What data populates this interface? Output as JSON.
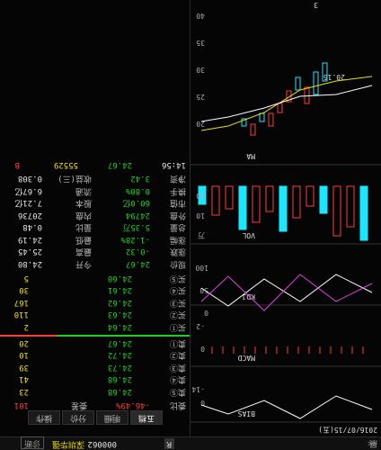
{
  "toolbar": {
    "back": "<<",
    "back_label": "展开",
    "flag": "R",
    "code": "000062",
    "name": "深圳华强",
    "news_btn": "诊断"
  },
  "tabs": [
    "五档",
    "明细",
    "分价",
    "操作"
  ],
  "webi": {
    "label": "委比",
    "value": "-46.49%",
    "diff_label": "委差",
    "diff": "101"
  },
  "sell": [
    {
      "label": "卖⑤",
      "price": "24.68",
      "vol": "23"
    },
    {
      "label": "卖④",
      "price": "24.68",
      "vol": "41"
    },
    {
      "label": "卖③",
      "price": "24.73",
      "vol": "39"
    },
    {
      "label": "卖②",
      "price": "24.72",
      "vol": "10"
    },
    {
      "label": "卖①",
      "price": "24.67",
      "vol": "20"
    }
  ],
  "buy": [
    {
      "label": "买①",
      "price": "24.64",
      "vol": "2"
    },
    {
      "label": "买②",
      "price": "24.63",
      "vol": "110"
    },
    {
      "label": "买③",
      "price": "24.62",
      "vol": "167"
    },
    {
      "label": "买④",
      "price": "24.61",
      "vol": "30"
    },
    {
      "label": "买⑤",
      "price": "24.60",
      "vol": "5"
    }
  ],
  "stats": [
    [
      "现价",
      "24.67",
      "今开",
      "24.80"
    ],
    [
      "涨跌",
      "-0.32",
      "最高",
      "25.45"
    ],
    [
      "涨幅",
      "-1.28%",
      "最低",
      "24.19"
    ],
    [
      "总量",
      "5.35万",
      "量比",
      "0.48"
    ],
    [
      "外盘",
      "24794",
      "内盘",
      "20736"
    ],
    [
      "市值",
      "60.0亿",
      "股本",
      "7.21亿"
    ],
    [
      "换手",
      "0.80%",
      "流通",
      "6.67亿"
    ],
    [
      "净资",
      "3.42",
      "收益(三)",
      "0.308"
    ]
  ],
  "tick": {
    "time": "14:56",
    "price": "24.67",
    "vol": "55529",
    "dir": "B"
  },
  "chart": {
    "date": "2016/07/15(五)",
    "kline_label": "MA",
    "price_ticks": [
      "40",
      "35",
      "30",
      "25",
      "20"
    ],
    "low_mark": "20.16",
    "vol_label": "VOL",
    "vol_ticks": [
      "20",
      "10",
      "万"
    ],
    "kdj_label": "KDJ",
    "kdj_ticks": [
      "100",
      "50",
      "0"
    ],
    "macd_label": "MACD",
    "macd_ticks": [
      "0",
      "-2"
    ],
    "bias_label": "BIAS",
    "bias_ticks": [
      "0",
      "-14"
    ],
    "bottom_num": "3",
    "icon_q": "?",
    "icon_x": "×"
  }
}
